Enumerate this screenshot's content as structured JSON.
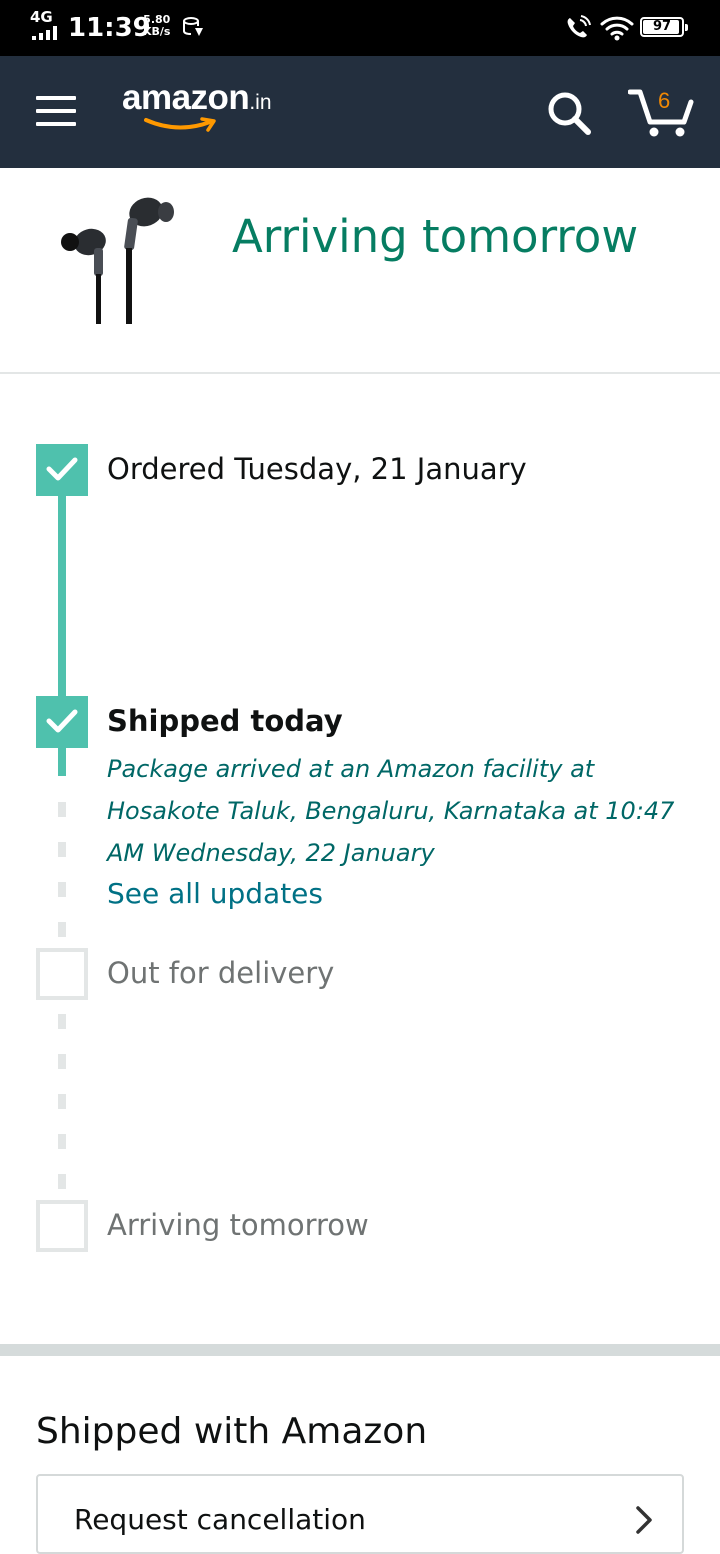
{
  "status_bar": {
    "network": "4G",
    "time": "11:39",
    "speed_value": "5.80",
    "speed_unit": "KB/s",
    "battery": "97"
  },
  "header": {
    "logo_text": "amazon",
    "logo_suffix": ".in",
    "cart_count": "6",
    "icons": [
      "menu-icon",
      "search-icon",
      "cart-icon"
    ]
  },
  "hero": {
    "title": "Arriving tomorrow"
  },
  "tracker": {
    "steps": [
      {
        "label": "Ordered Tuesday, 21 January",
        "status": "done"
      },
      {
        "label": "Shipped today",
        "status": "done",
        "detail": "Package arrived at an Amazon facility at Hosakote Taluk, Bengaluru, Karnataka at 10:47 AM Wednesday, 22 January",
        "link": "See all updates"
      },
      {
        "label": "Out for delivery",
        "status": "pending"
      },
      {
        "label": "Arriving tomorrow",
        "status": "pending"
      }
    ]
  },
  "shipping_section": {
    "title": "Shipped with Amazon",
    "action_label": "Request cancellation"
  },
  "colors": {
    "header_bg": "#232f3e",
    "accent_teal": "#4fc1ad",
    "title_green": "#067d62",
    "link_teal": "#007185",
    "cart_orange": "#f08804"
  }
}
